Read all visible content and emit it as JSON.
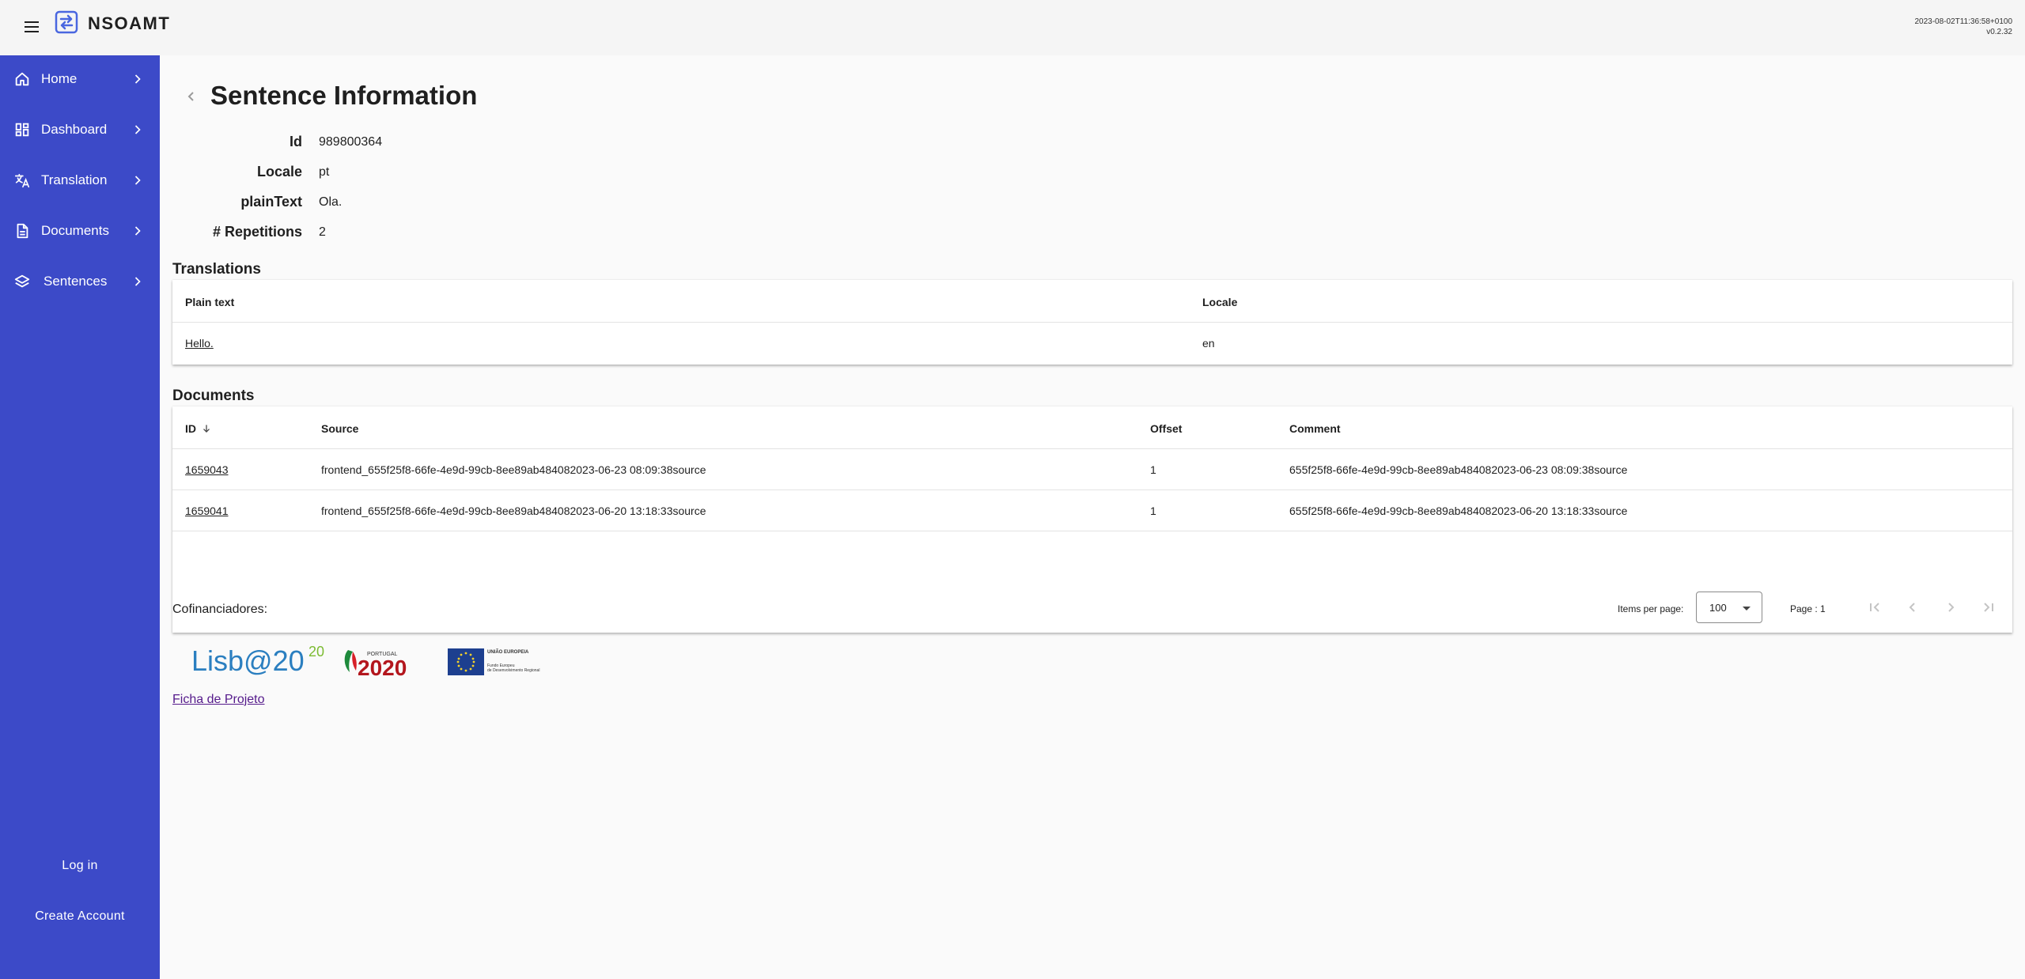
{
  "app": {
    "brand": "NSOAMT",
    "build_time": "2023-08-02T11:36:58+0100",
    "version": "v0.2.32"
  },
  "sidebar": {
    "items": [
      {
        "label": "Home",
        "icon": "home-icon"
      },
      {
        "label": "Dashboard",
        "icon": "dashboard-icon"
      },
      {
        "label": "Translation",
        "icon": "translate-icon"
      },
      {
        "label": "Documents",
        "icon": "document-icon"
      },
      {
        "label": "Sentences",
        "icon": "layers-icon"
      }
    ],
    "login_label": "Log in",
    "create_account_label": "Create Account"
  },
  "page": {
    "title": "Sentence Information"
  },
  "info": {
    "id_label": "Id",
    "id_value": "989800364",
    "locale_label": "Locale",
    "locale_value": "pt",
    "plaintext_label": "plainText",
    "plaintext_value": "Ola.",
    "repetitions_label": "# Repetitions",
    "repetitions_value": "2"
  },
  "translations": {
    "title": "Translations",
    "columns": [
      "Plain text",
      "Locale"
    ],
    "rows": [
      {
        "plain_text": "Hello.",
        "locale": "en"
      }
    ]
  },
  "documents": {
    "title": "Documents",
    "columns": [
      "ID",
      "Source",
      "Offset",
      "Comment"
    ],
    "rows": [
      {
        "id": "1659043",
        "source": "frontend_655f25f8-66fe-4e9d-99cb-8ee89ab484082023-06-23 08:09:38source",
        "offset": "1",
        "comment": "655f25f8-66fe-4e9d-99cb-8ee89ab484082023-06-23 08:09:38source"
      },
      {
        "id": "1659041",
        "source": "frontend_655f25f8-66fe-4e9d-99cb-8ee89ab484082023-06-20 13:18:33source",
        "offset": "1",
        "comment": "655f25f8-66fe-4e9d-99cb-8ee89ab484082023-06-20 13:18:33source"
      }
    ],
    "paginator": {
      "items_per_page_label": "Items per page:",
      "items_per_page_value": "100",
      "page_label": "Page : 1"
    }
  },
  "footer": {
    "cofin_label": "Cofinanciadores:",
    "logos": {
      "lisboa": "Lisb@20",
      "lisboa_sup": "20",
      "portugal_top": "PORTUGAL",
      "portugal": "2020",
      "eu_title": "UNIÃO EUROPEIA",
      "eu_line1": "Fundo Europeu",
      "eu_line2": "de Desenvolvimento Regional"
    },
    "project_link": "Ficha de Projeto"
  },
  "colors": {
    "sidebar": "#3c4ac8",
    "topbar": "#f5f5f5",
    "background": "#fafafa",
    "link_visited": "#551a8b",
    "brand_icon": "#4a67e0"
  }
}
